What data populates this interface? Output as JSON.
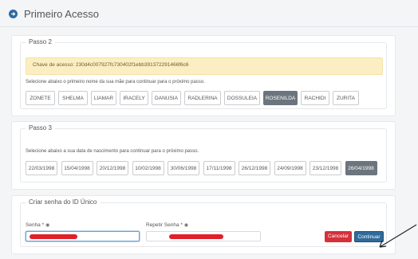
{
  "header": {
    "title": "Primeiro Acesso"
  },
  "step2": {
    "legend": "Passo 2",
    "key_text": "Chave de acesso: 230d4c007927fc730402f1ebb391372291466f6c6",
    "hint": "Selecione abaixo o primeiro nome da sua mãe para continuar para o próximo passo.",
    "names": [
      "ZONETE",
      "SHELMA",
      "LIAMAR",
      "IRACELY",
      "DANUSIA",
      "RADLERINA",
      "DOSSULEIA",
      "ROSENILDA",
      "RACHIDI",
      "ZURITA"
    ],
    "selected": "ROSENILDA"
  },
  "step3": {
    "legend": "Passo 3",
    "hint": "Selecione abaixo a sua data de nascimento para continuar para o próximo passo.",
    "dates": [
      "22/03/1998",
      "15/04/1998",
      "20/12/1998",
      "10/02/1998",
      "30/06/1998",
      "17/11/1998",
      "26/12/1998",
      "24/09/1998",
      "23/12/1998",
      "26/04/1998"
    ],
    "selected": "26/04/1998"
  },
  "password": {
    "legend": "Criar senha do ID Único",
    "senha_label": "Senha *",
    "repetir_label": "Repetir Senha *",
    "cancel_label": "Cancelar",
    "continue_label": "Continuar"
  },
  "colors": {
    "accent": "#2d6aa3",
    "selected": "#6c757d",
    "danger": "#d6303b",
    "alert_bg": "#fbeec3"
  }
}
